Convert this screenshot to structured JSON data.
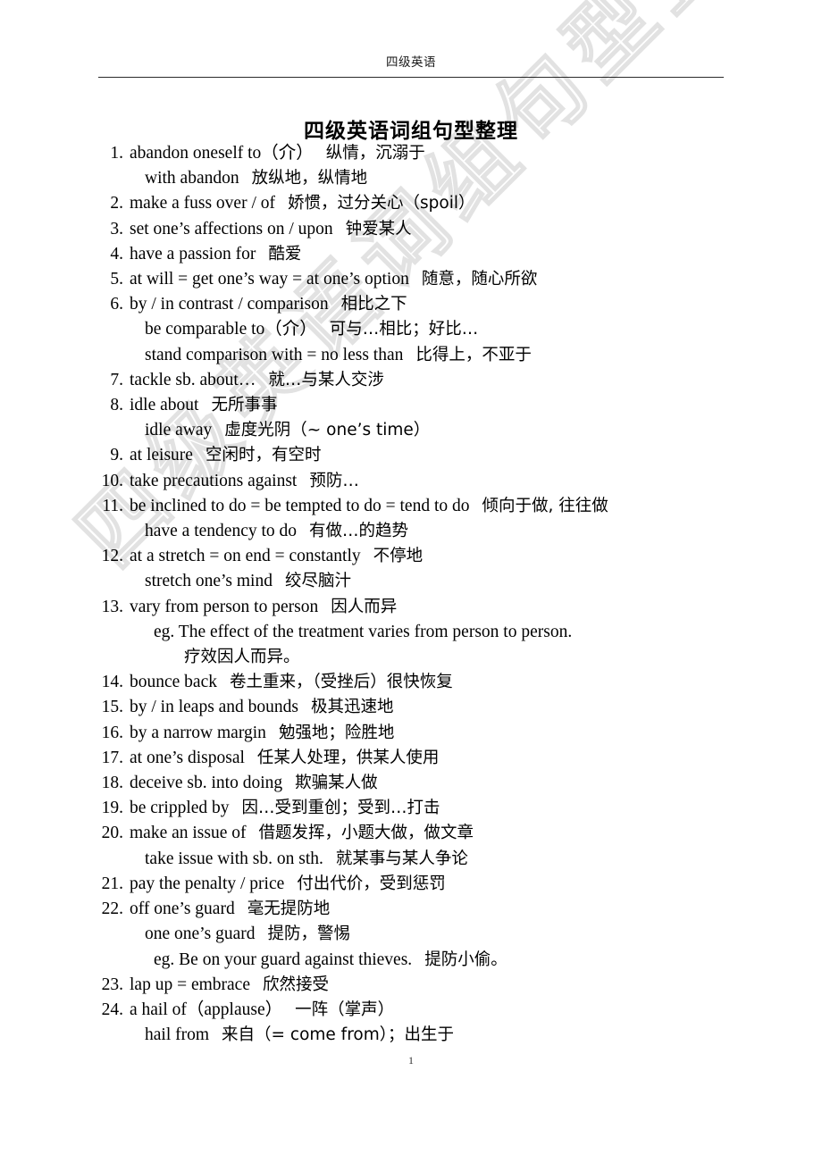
{
  "header": {
    "running_title": "四级英语"
  },
  "title": "四级英语词组句型整理",
  "watermark": {
    "text": "四级英语词组句型整理"
  },
  "footer": {
    "page_number": "1"
  },
  "entries": [
    {
      "num": "1.",
      "lines": [
        {
          "kind": "main",
          "en": "abandon oneself to（介）",
          "zh": "纵情，沉溺于"
        },
        {
          "kind": "cont",
          "en": "with abandon",
          "zh": "放纵地，纵情地"
        }
      ]
    },
    {
      "num": "2.",
      "lines": [
        {
          "kind": "main",
          "en": "make a fuss over / of",
          "zh": "娇惯，过分关心（spoil）"
        }
      ]
    },
    {
      "num": "3.",
      "lines": [
        {
          "kind": "main",
          "en": "set one’s affections on / upon",
          "zh": "钟爱某人"
        }
      ]
    },
    {
      "num": "4.",
      "lines": [
        {
          "kind": "main",
          "en": "have a passion for",
          "zh": "酷爱"
        }
      ]
    },
    {
      "num": "5.",
      "lines": [
        {
          "kind": "main",
          "en": "at will = get one’s way = at one’s option",
          "zh": "随意，随心所欲"
        }
      ]
    },
    {
      "num": "6.",
      "lines": [
        {
          "kind": "main",
          "en": "by / in contrast / comparison",
          "zh": "相比之下"
        },
        {
          "kind": "cont",
          "en": "be comparable to（介）",
          "zh": "可与…相比；好比…"
        },
        {
          "kind": "cont",
          "en": "stand comparison with = no less than",
          "zh": "比得上，不亚于"
        }
      ]
    },
    {
      "num": "7.",
      "lines": [
        {
          "kind": "main",
          "en": "tackle sb. about…",
          "zh": "就…与某人交涉"
        }
      ]
    },
    {
      "num": "8.",
      "lines": [
        {
          "kind": "main",
          "en": "idle about",
          "zh": "无所事事"
        },
        {
          "kind": "cont",
          "en": "idle away",
          "zh": "虚度光阴（~ one’s time）"
        }
      ]
    },
    {
      "num": "9.",
      "lines": [
        {
          "kind": "main",
          "en": "at leisure",
          "zh": "空闲时，有空时"
        }
      ]
    },
    {
      "num": "10.",
      "lines": [
        {
          "kind": "main",
          "en": "take precautions against",
          "zh": "预防…"
        }
      ]
    },
    {
      "num": "11.",
      "lines": [
        {
          "kind": "main",
          "en": "be inclined to do = be tempted to do = tend to do",
          "zh": "倾向于做, 往往做"
        },
        {
          "kind": "cont",
          "en": "have a tendency to do",
          "zh": "有做…的趋势"
        }
      ]
    },
    {
      "num": "12.",
      "lines": [
        {
          "kind": "main",
          "en": "at a stretch = on end = constantly",
          "zh": "不停地"
        },
        {
          "kind": "cont",
          "en": "stretch one’s mind",
          "zh": "绞尽脑汁"
        }
      ]
    },
    {
      "num": "13.",
      "lines": [
        {
          "kind": "main",
          "en": "vary from person to person",
          "zh": "因人而异"
        },
        {
          "kind": "eg",
          "en": "eg. The effect of the treatment varies from person to person.",
          "zh": ""
        },
        {
          "kind": "eg-sub",
          "en": "",
          "zh": "疗效因人而异。"
        }
      ]
    },
    {
      "num": "14.",
      "lines": [
        {
          "kind": "main",
          "en": "bounce back",
          "zh": "卷土重来，（受挫后）很快恢复"
        }
      ]
    },
    {
      "num": "15.",
      "lines": [
        {
          "kind": "main",
          "en": "by / in leaps and bounds",
          "zh": "极其迅速地"
        }
      ]
    },
    {
      "num": "16.",
      "lines": [
        {
          "kind": "main",
          "en": "by a narrow margin",
          "zh": "勉强地；险胜地"
        }
      ]
    },
    {
      "num": "17.",
      "lines": [
        {
          "kind": "main",
          "en": "at one’s disposal",
          "zh": "任某人处理，供某人使用"
        }
      ]
    },
    {
      "num": "18.",
      "lines": [
        {
          "kind": "main",
          "en": "deceive sb. into doing",
          "zh": "欺骗某人做"
        }
      ]
    },
    {
      "num": "19.",
      "lines": [
        {
          "kind": "main",
          "en": "be crippled by",
          "zh": "因…受到重创；受到…打击"
        }
      ]
    },
    {
      "num": "20.",
      "lines": [
        {
          "kind": "main",
          "en": "make an issue of",
          "zh": "借题发挥，小题大做，做文章"
        },
        {
          "kind": "cont",
          "en": "take issue with sb. on sth.",
          "zh": "就某事与某人争论"
        }
      ]
    },
    {
      "num": "21.",
      "lines": [
        {
          "kind": "main",
          "en": "pay the penalty / price",
          "zh": "付出代价，受到惩罚"
        }
      ]
    },
    {
      "num": "22.",
      "lines": [
        {
          "kind": "main",
          "en": "off one’s guard",
          "zh": "毫无提防地"
        },
        {
          "kind": "cont",
          "en": "one one’s guard",
          "zh": "提防，警惕"
        },
        {
          "kind": "eg",
          "en": "eg. Be on your guard against thieves.",
          "zh": "提防小偷。"
        }
      ]
    },
    {
      "num": "23.",
      "lines": [
        {
          "kind": "main",
          "en": "lap up = embrace",
          "zh": "欣然接受"
        }
      ]
    },
    {
      "num": "24.",
      "lines": [
        {
          "kind": "main",
          "en": "a hail of（applause）",
          "zh": "一阵（掌声）"
        },
        {
          "kind": "cont",
          "en": "hail from",
          "zh": "来自（= come from）；出生于"
        }
      ]
    }
  ]
}
